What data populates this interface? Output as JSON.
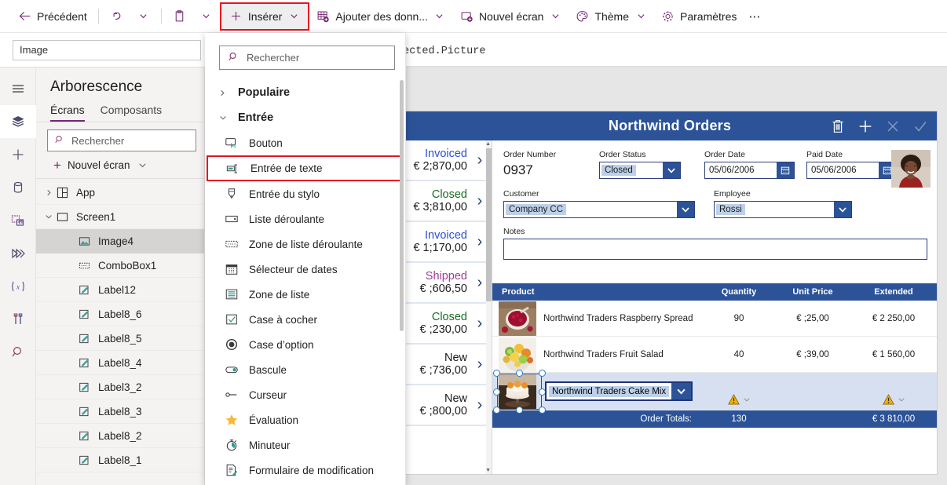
{
  "commandbar": {
    "items": [
      {
        "label": "Précédent",
        "icon": "back-arrow-icon",
        "chevron": false
      },
      {
        "label": "",
        "icon": "undo-icon",
        "chevron": true
      },
      {
        "label": "",
        "icon": "clipboard-icon",
        "chevron": true
      },
      {
        "label": "Insérer",
        "icon": "plus-icon",
        "chevron": true,
        "highlighted": true
      },
      {
        "label": "Ajouter des donn...",
        "icon": "add-data-icon",
        "chevron": true
      },
      {
        "label": "Nouvel écran",
        "icon": "new-screen-icon",
        "chevron": true
      },
      {
        "label": "Thème",
        "icon": "palette-icon",
        "chevron": true
      },
      {
        "label": "Paramètres",
        "icon": "gear-icon",
        "chevron": false
      }
    ],
    "overflow_label": "⋯"
  },
  "formula_bar": {
    "property_value": "Image",
    "formula_text": "lected.Picture"
  },
  "rail": {
    "items": [
      {
        "name": "hamburger-menu-icon"
      },
      {
        "name": "tree-view-icon",
        "active": true
      },
      {
        "name": "insert-plus-icon"
      },
      {
        "name": "data-icon"
      },
      {
        "name": "media-icon"
      },
      {
        "name": "power-automate-icon"
      },
      {
        "name": "variables-icon"
      },
      {
        "name": "tools-icon"
      },
      {
        "name": "search-icon"
      }
    ]
  },
  "tree": {
    "title": "Arborescence",
    "tabs": [
      {
        "label": "Écrans",
        "active": true
      },
      {
        "label": "Composants",
        "active": false
      }
    ],
    "search_placeholder": "Rechercher",
    "new_screen_label": "Nouvel écran",
    "nodes": [
      {
        "label": "App",
        "level": 0,
        "twisty": "collapsed",
        "icon": "app-icon"
      },
      {
        "label": "Screen1",
        "level": 0,
        "twisty": "expanded",
        "icon": "screen-icon"
      },
      {
        "label": "Image4",
        "level": 2,
        "twisty": "none",
        "icon": "image-icon",
        "selected": true
      },
      {
        "label": "ComboBox1",
        "level": 2,
        "twisty": "none",
        "icon": "combobox-icon"
      },
      {
        "label": "Label12",
        "level": 2,
        "twisty": "none",
        "icon": "label-icon"
      },
      {
        "label": "Label8_6",
        "level": 2,
        "twisty": "none",
        "icon": "label-icon"
      },
      {
        "label": "Label8_5",
        "level": 2,
        "twisty": "none",
        "icon": "label-icon"
      },
      {
        "label": "Label8_4",
        "level": 2,
        "twisty": "none",
        "icon": "label-icon"
      },
      {
        "label": "Label3_2",
        "level": 2,
        "twisty": "none",
        "icon": "label-icon"
      },
      {
        "label": "Label8_3",
        "level": 2,
        "twisty": "none",
        "icon": "label-icon"
      },
      {
        "label": "Label8_2",
        "level": 2,
        "twisty": "none",
        "icon": "label-icon"
      },
      {
        "label": "Label8_1",
        "level": 2,
        "twisty": "none",
        "icon": "label-icon"
      }
    ]
  },
  "insert_flyout": {
    "search_placeholder": "Rechercher",
    "entries": [
      {
        "type": "group",
        "label": "Populaire",
        "twisty": "collapsed"
      },
      {
        "type": "group",
        "label": "Entrée",
        "twisty": "expanded"
      },
      {
        "type": "item",
        "label": "Bouton",
        "icon": "button-icon"
      },
      {
        "type": "item",
        "label": "Entrée de texte",
        "icon": "text-input-icon",
        "highlighted": true
      },
      {
        "type": "item",
        "label": "Entrée du stylo",
        "icon": "pen-input-icon"
      },
      {
        "type": "item",
        "label": "Liste déroulante",
        "icon": "dropdown-icon"
      },
      {
        "type": "item",
        "label": "Zone de liste déroulante",
        "icon": "combobox-icon"
      },
      {
        "type": "item",
        "label": "Sélecteur de dates",
        "icon": "date-picker-icon"
      },
      {
        "type": "item",
        "label": "Zone de liste",
        "icon": "listbox-icon"
      },
      {
        "type": "item",
        "label": "Case à cocher",
        "icon": "checkbox-icon"
      },
      {
        "type": "item",
        "label": "Case d’option",
        "icon": "radio-icon"
      },
      {
        "type": "item",
        "label": "Bascule",
        "icon": "toggle-icon"
      },
      {
        "type": "item",
        "label": "Curseur",
        "icon": "slider-icon"
      },
      {
        "type": "item",
        "label": "Évaluation",
        "icon": "star-rating-icon"
      },
      {
        "type": "item",
        "label": "Minuteur",
        "icon": "timer-icon"
      },
      {
        "type": "item",
        "label": "Formulaire de modification",
        "icon": "edit-form-icon"
      }
    ]
  },
  "app": {
    "header": {
      "title": "Northwind Orders",
      "icons": [
        {
          "name": "trash-icon",
          "dim": false
        },
        {
          "name": "plus-icon",
          "dim": false
        },
        {
          "name": "close-x-icon",
          "dim": true
        },
        {
          "name": "checkmark-icon",
          "dim": true
        }
      ]
    },
    "gallery": [
      {
        "status": "Invoiced",
        "amount": "€ 2;870,00",
        "status_class": "st-invoiced"
      },
      {
        "status": "Closed",
        "amount": "€ 3;810,00",
        "status_class": "st-closed"
      },
      {
        "status": "Invoiced",
        "amount": "€ 1;170,00",
        "status_class": "st-invoiced"
      },
      {
        "status": "Shipped",
        "amount": "€ ;606,50",
        "status_class": "st-shipped"
      },
      {
        "status": "Closed",
        "amount": "€ ;230,00",
        "status_class": "st-closed"
      },
      {
        "status": "New",
        "amount": "€ ;736,00",
        "status_class": "st-new"
      },
      {
        "status": "New",
        "amount": "€ ;800,00",
        "status_class": "st-new"
      }
    ],
    "form": {
      "order_number_label": "Order Number",
      "order_number_value": "0937",
      "order_status_label": "Order Status",
      "order_status_value": "Closed",
      "order_date_label": "Order Date",
      "order_date_value": "05/06/2006",
      "paid_date_label": "Paid Date",
      "paid_date_value": "05/06/2006",
      "customer_label": "Customer",
      "customer_value": "Company CC",
      "employee_label": "Employee",
      "employee_value": "Rossi",
      "notes_label": "Notes",
      "notes_value": ""
    },
    "table": {
      "headers": {
        "product": "Product",
        "quantity": "Quantity",
        "unit_price": "Unit Price",
        "extended": "Extended"
      },
      "rows": [
        {
          "product": "Northwind Traders Raspberry Spread",
          "quantity": "90",
          "unit_price": "€ ;25,00",
          "extended": "€ 2 250,00",
          "image": "raspberry-spread-image"
        },
        {
          "product": "Northwind Traders Fruit Salad",
          "quantity": "40",
          "unit_price": "€ ;39,00",
          "extended": "€ 1 560,00",
          "image": "fruit-salad-image"
        }
      ],
      "editing_row": {
        "product": "Northwind Traders Cake Mix",
        "image": "cake-mix-image",
        "warning_icon": "warning-triangle-icon"
      },
      "totals": {
        "label": "Order Totals:",
        "quantity": "130",
        "extended": "€ 3 810,00"
      }
    }
  },
  "colors": {
    "accent_purple": "#742774",
    "app_blue": "#2c5398",
    "highlight_red": "#e81123",
    "status_invoiced": "#2b4fd8",
    "status_closed": "#1b6b26",
    "status_shipped": "#a13a9c",
    "warning_yellow": "#f2b200"
  }
}
